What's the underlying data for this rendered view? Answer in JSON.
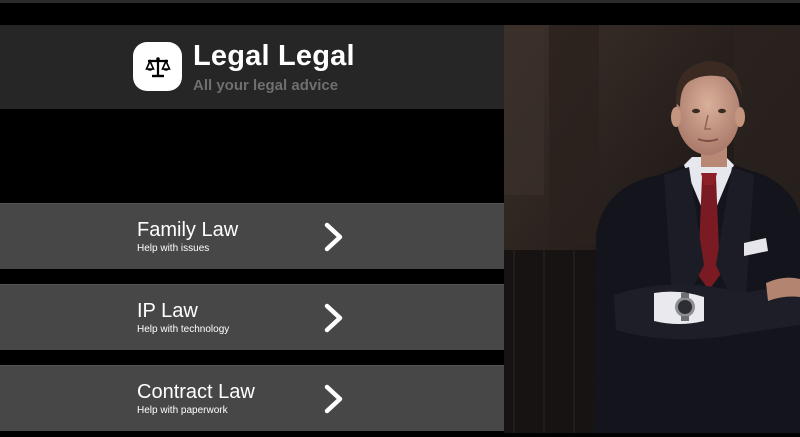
{
  "brand": {
    "title": "Legal Legal",
    "tagline": "All your legal advice",
    "logo_icon": "scales-icon"
  },
  "services": [
    {
      "label": "Family Law",
      "sub": "Help with issues"
    },
    {
      "label": "IP Law",
      "sub": "Help with technology"
    },
    {
      "label": "Contract Law",
      "sub": "Help with paperwork"
    }
  ],
  "colors": {
    "header_bg": "#262626",
    "item_bg": "#474747",
    "tagline": "#6f6f6f",
    "page_bg": "#000000"
  }
}
